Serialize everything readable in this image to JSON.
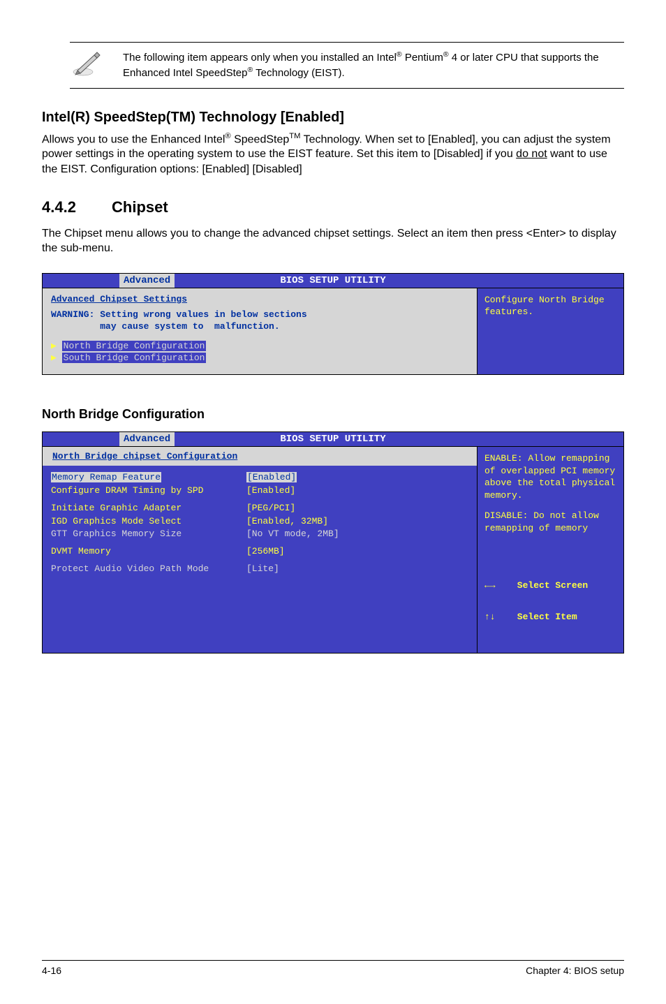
{
  "note": {
    "text_before_reg1": "The following item appears only when you installed an Intel",
    "reg1": "®",
    "text_mid1": " Pentium",
    "reg2": "®",
    "text_mid2": " 4 or later CPU that supports the Enhanced Intel SpeedStep",
    "reg3": "®",
    "text_after": " Technology (EIST)."
  },
  "sec1": {
    "heading": "Intel(R) SpeedStep(TM) Technology [Enabled]",
    "p1_a": "Allows you to use the Enhanced Intel",
    "p1_reg": "®",
    "p1_b": " SpeedStep",
    "p1_tm": "TM",
    "p1_c": " Technology. When set to [Enabled], you can adjust the system power settings in the operating system to use the EIST feature. Set this item to [Disabled] if you ",
    "p1_underline": "do not",
    "p1_d": " want to use the EIST. Configuration options: [Enabled] [Disabled]"
  },
  "sec2": {
    "num": "4.4.2",
    "title": "Chipset",
    "body": "The Chipset menu allows you to change the advanced chipset settings. Select an item then press <Enter> to display the sub-menu."
  },
  "bios1": {
    "header": "BIOS SETUP UTILITY",
    "tab": "Advanced",
    "title": "Advanced Chipset Settings",
    "warn": "WARNING: Setting wrong values in below sections\n         may cause system to  malfunction.",
    "item1": "North Bridge Configuration",
    "item2": "South Bridge Configuration",
    "help": "Configure North Bridge features."
  },
  "sub1": {
    "heading": "North Bridge Configuration"
  },
  "bios2": {
    "header": "BIOS SETUP UTILITY",
    "tab": "Advanced",
    "title": "North Bridge chipset Configuration",
    "rows": [
      {
        "k": "Memory Remap Feature",
        "v": "[Enabled]",
        "hl": true
      },
      {
        "k": "Configure DRAM Timing by SPD",
        "v": "[Enabled]",
        "yellow": true
      }
    ],
    "rows2": [
      {
        "k": "Initiate Graphic Adapter",
        "v": "[PEG/PCI]",
        "yellow": true
      },
      {
        "k": "IGD Graphics Mode Select",
        "v": "[Enabled, 32MB]",
        "yellow": true
      },
      {
        "k": "GTT Graphics Memory Size",
        "v": "[No VT mode, 2MB]",
        "gray": true
      }
    ],
    "rows3": [
      {
        "k": "DVMT Memory",
        "v": "[256MB]",
        "yellow": true
      }
    ],
    "rows4": [
      {
        "k": "Protect Audio Video Path Mode",
        "v": "[Lite]",
        "gray": true
      }
    ],
    "help1": "ENABLE: Allow remapping of overlapped PCI memory above the total physical memory.",
    "help2": "DISABLE: Do not allow remapping of memory",
    "nav1": "←→    Select Screen",
    "nav2": "↑↓    Select Item"
  },
  "footer": {
    "left": "4-16",
    "right": "Chapter 4: BIOS setup"
  }
}
